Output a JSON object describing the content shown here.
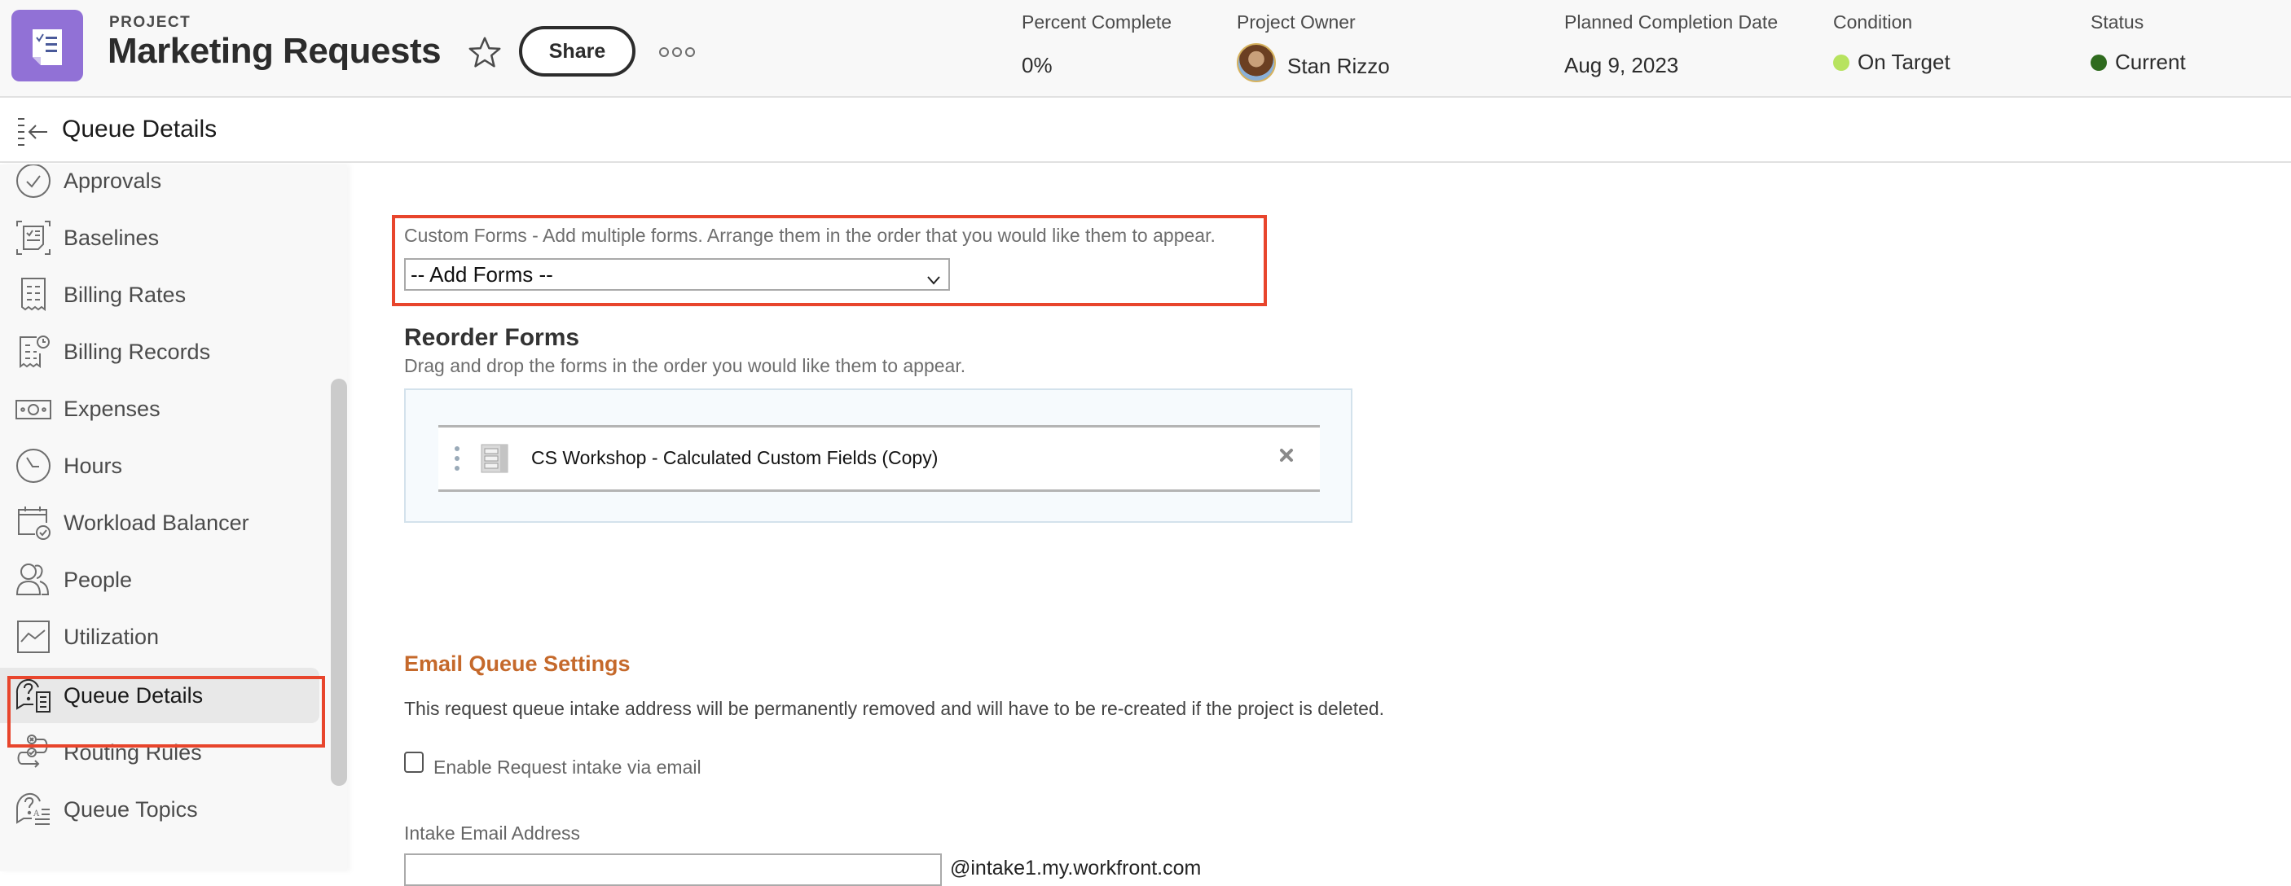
{
  "header": {
    "kicker": "PROJECT",
    "title": "Marketing Requests",
    "share_label": "Share",
    "meta": {
      "percent_complete": {
        "label": "Percent Complete",
        "value": "0%"
      },
      "project_owner": {
        "label": "Project Owner",
        "value": "Stan Rizzo"
      },
      "planned_completion": {
        "label": "Planned Completion Date",
        "value": "Aug 9, 2023"
      },
      "condition": {
        "label": "Condition",
        "value": "On Target",
        "color": "#b7e35f"
      },
      "status": {
        "label": "Status",
        "value": "Current",
        "color": "#2f6b1e"
      }
    }
  },
  "subheader": {
    "title": "Queue Details"
  },
  "sidebar": {
    "items": [
      {
        "label": "Approvals",
        "icon": "approval-check-icon"
      },
      {
        "label": "Baselines",
        "icon": "baseline-icon"
      },
      {
        "label": "Billing Rates",
        "icon": "receipt-icon"
      },
      {
        "label": "Billing Records",
        "icon": "receipt-clock-icon"
      },
      {
        "label": "Expenses",
        "icon": "money-icon"
      },
      {
        "label": "Hours",
        "icon": "clock-icon"
      },
      {
        "label": "Workload Balancer",
        "icon": "calendar-check-icon"
      },
      {
        "label": "People",
        "icon": "people-icon"
      },
      {
        "label": "Utilization",
        "icon": "chart-line-icon"
      },
      {
        "label": "Queue Details",
        "icon": "queue-details-icon",
        "active": true
      },
      {
        "label": "Routing Rules",
        "icon": "routing-rules-icon"
      },
      {
        "label": "Queue Topics",
        "icon": "queue-topics-icon"
      }
    ]
  },
  "custom_forms": {
    "description": "Custom Forms - Add multiple forms. Arrange them in the order that you would like them to appear.",
    "select_value": "-- Add Forms --"
  },
  "reorder": {
    "title": "Reorder Forms",
    "description": "Drag and drop the forms in the order you would like them to appear.",
    "forms": [
      {
        "name": "CS Workshop - Calculated Custom Fields (Copy)"
      }
    ]
  },
  "email_queue": {
    "title": "Email Queue Settings",
    "description": "This request queue intake address will be permanently removed and will have to be re-created if the project is deleted.",
    "checkbox_label": "Enable Request intake via email",
    "checkbox_checked": false,
    "intake_label": "Intake Email Address",
    "intake_value": "",
    "intake_domain": "@intake1.my.workfront.com"
  },
  "colors": {
    "accent_highlight": "#e8452c",
    "project_icon": "#9171d6",
    "section_title": "#c5692b"
  }
}
